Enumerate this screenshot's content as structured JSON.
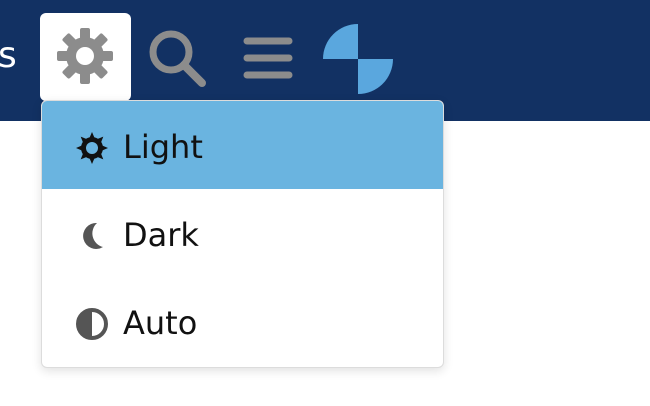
{
  "topbar": {
    "cut_text": "s",
    "background_color": "#123163"
  },
  "toolbar": {
    "icons": [
      "gear-icon",
      "search-icon",
      "menu-icon",
      "logo-icon"
    ]
  },
  "theme_menu": {
    "items": [
      {
        "label": "Light",
        "icon": "sun-icon",
        "selected": true
      },
      {
        "label": "Dark",
        "icon": "moon-icon",
        "selected": false
      },
      {
        "label": "Auto",
        "icon": "half-circle-icon",
        "selected": false
      }
    ],
    "active_color": "#6ab4e0"
  }
}
